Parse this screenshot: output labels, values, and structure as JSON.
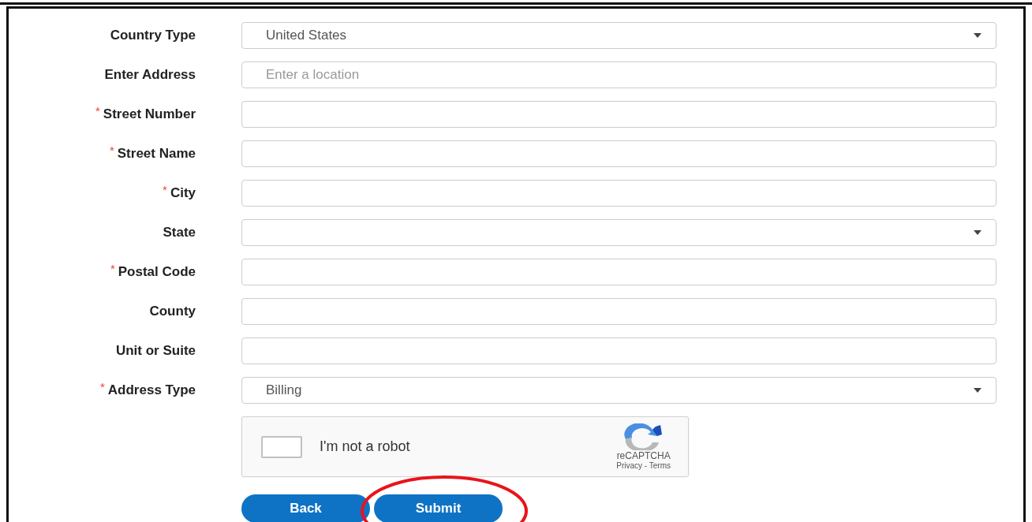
{
  "fields": [
    {
      "label": "Country Type",
      "kind": "select",
      "value": "United States"
    },
    {
      "label": "Enter Address",
      "kind": "text",
      "placeholder": "Enter a location"
    },
    {
      "marker": "*",
      "label": "Street Number",
      "kind": "text"
    },
    {
      "marker": "*",
      "label": "Street Name",
      "kind": "text"
    },
    {
      "marker": "*",
      "label": "City",
      "kind": "text"
    },
    {
      "label": "State",
      "kind": "select"
    },
    {
      "marker": "*",
      "label": "Postal Code",
      "kind": "text"
    },
    {
      "label": "County",
      "kind": "text"
    },
    {
      "label": "Unit or Suite",
      "kind": "text"
    },
    {
      "marker": "*",
      "label": "Address Type",
      "kind": "select",
      "value": "Billing"
    }
  ],
  "captcha": {
    "checked": false,
    "label": "I'm not a robot",
    "brand": "reCAPTCHA",
    "links": "Privacy - Terms"
  },
  "buttons": [
    {
      "label": "Back",
      "highlighted": false
    },
    {
      "label": "Submit",
      "highlighted": true
    }
  ]
}
